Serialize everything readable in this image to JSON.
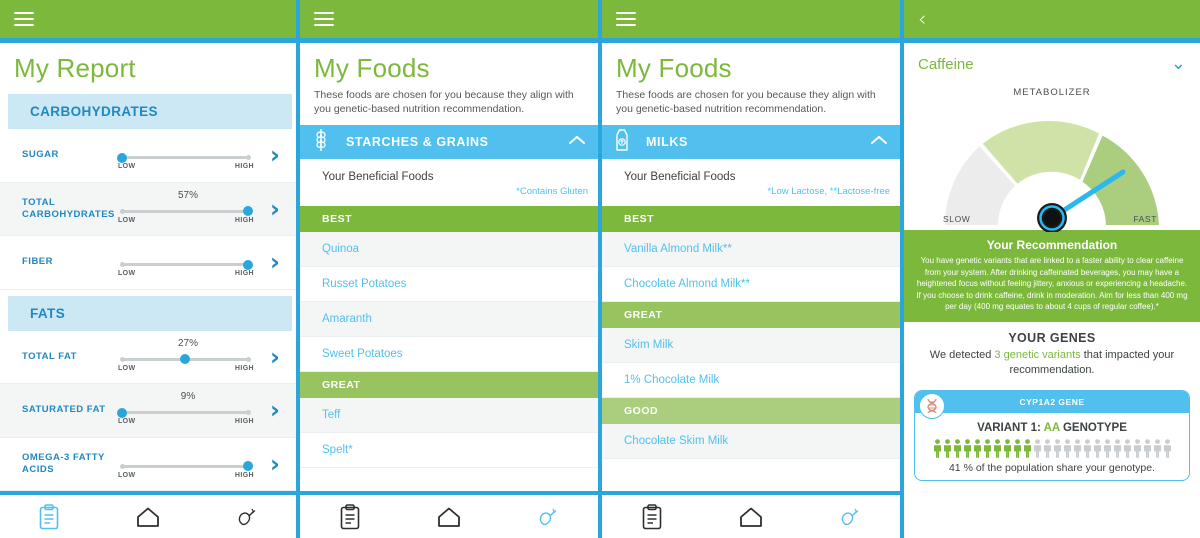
{
  "colors": {
    "green": "#7cb83c",
    "blue": "#2ba6dd",
    "light_blue": "#51c0ef",
    "header_blue_bg": "#cbe8f4",
    "text_blue": "#2088c2"
  },
  "panel_report": {
    "menu_icon": "hamburger-icon",
    "title": "My Report",
    "sections": [
      {
        "heading": "CARBOHYDRATES",
        "rows": [
          {
            "name": "SUGAR",
            "percent": "",
            "position": 0,
            "low": "LOW",
            "high": "HIGH"
          },
          {
            "name": "TOTAL CARBOHYDRATES",
            "percent": "57%",
            "position": 100,
            "low": "LOW",
            "high": "HIGH"
          },
          {
            "name": "FIBER",
            "percent": "",
            "position": 100,
            "low": "LOW",
            "high": "HIGH"
          }
        ]
      },
      {
        "heading": "FATS",
        "rows": [
          {
            "name": "TOTAL FAT",
            "percent": "27%",
            "position": 50,
            "low": "LOW",
            "high": "HIGH"
          },
          {
            "name": "SATURATED FAT",
            "percent": "9%",
            "position": 0,
            "low": "LOW",
            "high": "HIGH"
          },
          {
            "name": "OMEGA-3 FATTY ACIDS",
            "percent": "",
            "position": 100,
            "low": "LOW",
            "high": "HIGH"
          }
        ]
      }
    ],
    "nav": {
      "reports": "clipboard-icon",
      "home": "home-icon",
      "foods": "carrot-icon",
      "active": "reports"
    }
  },
  "panel_foods_grains": {
    "menu_icon": "hamburger-icon",
    "title": "My Foods",
    "subtitle": "These foods are chosen for you because they align with you genetic-based nutrition recommendation.",
    "category": {
      "icon": "wheat-icon",
      "label": "STARCHES & GRAINS",
      "collapse_icon": "chevron-up-icon"
    },
    "beneficial_label": "Your Beneficial Foods",
    "note": "*Contains Gluten",
    "groups": [
      {
        "grade": "BEST",
        "items": [
          "Quinoa",
          "Russet Potatoes",
          "Amaranth",
          "Sweet Potatoes"
        ]
      },
      {
        "grade": "GREAT",
        "items": [
          "Teff",
          "Spelt*"
        ]
      }
    ],
    "nav": {
      "reports": "clipboard-icon",
      "home": "home-icon",
      "foods": "carrot-icon",
      "active": "foods"
    }
  },
  "panel_foods_milks": {
    "menu_icon": "hamburger-icon",
    "title": "My Foods",
    "subtitle": "These foods are chosen for you because they align with you genetic-based nutrition recommendation.",
    "category": {
      "icon": "milk-carton-icon",
      "label": "MILKS",
      "collapse_icon": "chevron-up-icon"
    },
    "beneficial_label": "Your Beneficial Foods",
    "note": "*Low Lactose, **Lactose-free",
    "groups": [
      {
        "grade": "BEST",
        "items": [
          "Vanilla Almond Milk**",
          "Chocolate Almond Milk**"
        ]
      },
      {
        "grade": "GREAT",
        "items": [
          "Skim Milk",
          "1% Chocolate Milk"
        ]
      },
      {
        "grade": "GOOD",
        "items": [
          "Chocolate Skim Milk"
        ]
      }
    ],
    "nav": {
      "reports": "clipboard-icon",
      "home": "home-icon",
      "foods": "carrot-icon",
      "active": "foods"
    }
  },
  "panel_caffeine": {
    "back_icon": "chevron-left-icon",
    "title": "Caffeine",
    "expand_icon": "chevron-down-icon",
    "gauge": {
      "label": "METABOLIZER",
      "min_label": "SLOW",
      "max_label": "FAST",
      "needle_value": 82,
      "segments": [
        {
          "name": "slow",
          "color": "#ececec",
          "span": 38
        },
        {
          "name": "moderate",
          "color": "#cfe3a8",
          "span": 34
        },
        {
          "name": "fast",
          "color": "#aacd7e",
          "span": 28
        }
      ]
    },
    "recommendation": {
      "title": "Your Recommendation",
      "text": "You have genetic variants that are linked to a faster ability to clear caffeine from your system. After drinking caffeinated beverages, you may have a heightened focus without feeling jittery, anxious or experiencing a headache. If you choose to drink caffeine, drink in moderation. Aim for less than 400 mg per day (400 mg equates to about 4 cups of regular coffee).*"
    },
    "genes": {
      "title": "YOUR GENES",
      "text_before": "We detected ",
      "highlight": "3 genetic variants",
      "text_after": " that impacted your recommendation."
    },
    "gene_card": {
      "dna_icon": "dna-icon",
      "gene_name": "CYP1A2 GENE",
      "variant_prefix": "VARIANT 1: ",
      "genotype": "AA",
      "variant_suffix": " GENOTYPE",
      "people_total": 24,
      "people_filled": 10,
      "population_text": "41 % of the population share your genotype."
    }
  }
}
